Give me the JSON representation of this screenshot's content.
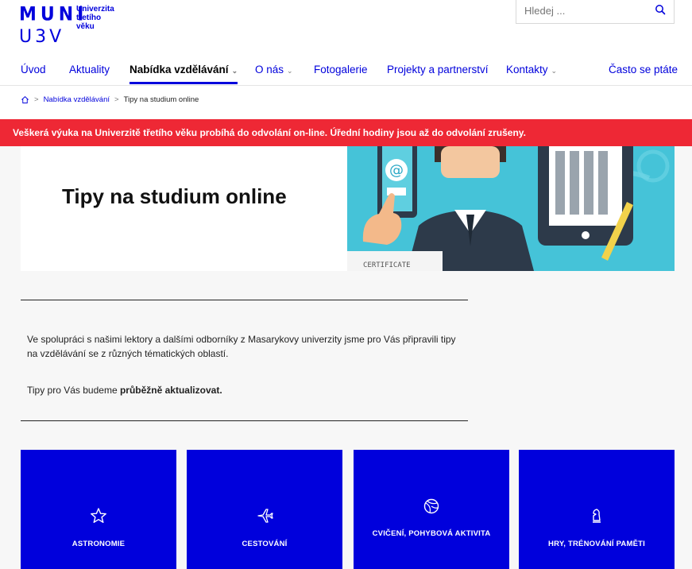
{
  "logo": {
    "line1": "MUNI",
    "line2": "U3V",
    "sub": [
      "Univerzita",
      "třetího",
      "věku"
    ]
  },
  "search": {
    "placeholder": "Hledej ...",
    "icon": "search-icon"
  },
  "nav": {
    "items": [
      {
        "label": "Úvod",
        "dropdown": false
      },
      {
        "label": "Aktuality",
        "dropdown": false
      },
      {
        "label": "Nabídka vzdělávání",
        "dropdown": true,
        "active": true
      },
      {
        "label": "O nás",
        "dropdown": true
      },
      {
        "label": "Fotogalerie",
        "dropdown": false
      },
      {
        "label": "Projekty a partnerství",
        "dropdown": false
      },
      {
        "label": "Kontakty",
        "dropdown": true
      },
      {
        "label": "Často se ptáte",
        "dropdown": false
      }
    ],
    "chevron": "⌄"
  },
  "breadcrumb": {
    "sep": ">",
    "items": [
      "Nabídka vzdělávání",
      "Tipy na studium online"
    ]
  },
  "alert": "Veškerá výuka na Univerzitě třetího věku probíhá do odvolání on-line. Úřední hodiny jsou až do odvolání zrušeny.",
  "hero": {
    "title": "Tipy na studium online",
    "image_text": "CERTIFICATE",
    "image_at": "@"
  },
  "intro": {
    "paragraph": "Ve spolupráci s našimi lektory a dalšími odborníky z Masarykovy univerzity jsme pro Vás připravili tipy na vzdělávání se z různých tématických oblastí.",
    "line_prefix": "Tipy pro Vás budeme ",
    "line_bold": "průběžně aktualizovat."
  },
  "tiles": [
    {
      "label": "ASTRONOMIE",
      "icon": "star-icon"
    },
    {
      "label": "CESTOVÁNÍ",
      "icon": "airplane-icon"
    },
    {
      "label": "CVIČENÍ, POHYBOVÁ AKTIVITA",
      "icon": "ball-icon"
    },
    {
      "label": "HRY, TRÉNOVÁNÍ PAMĚTI",
      "icon": "chess-icon"
    }
  ],
  "colors": {
    "brand_blue": "#0000dc",
    "alert_red": "#ee2835",
    "background": "#f7f7f7"
  }
}
